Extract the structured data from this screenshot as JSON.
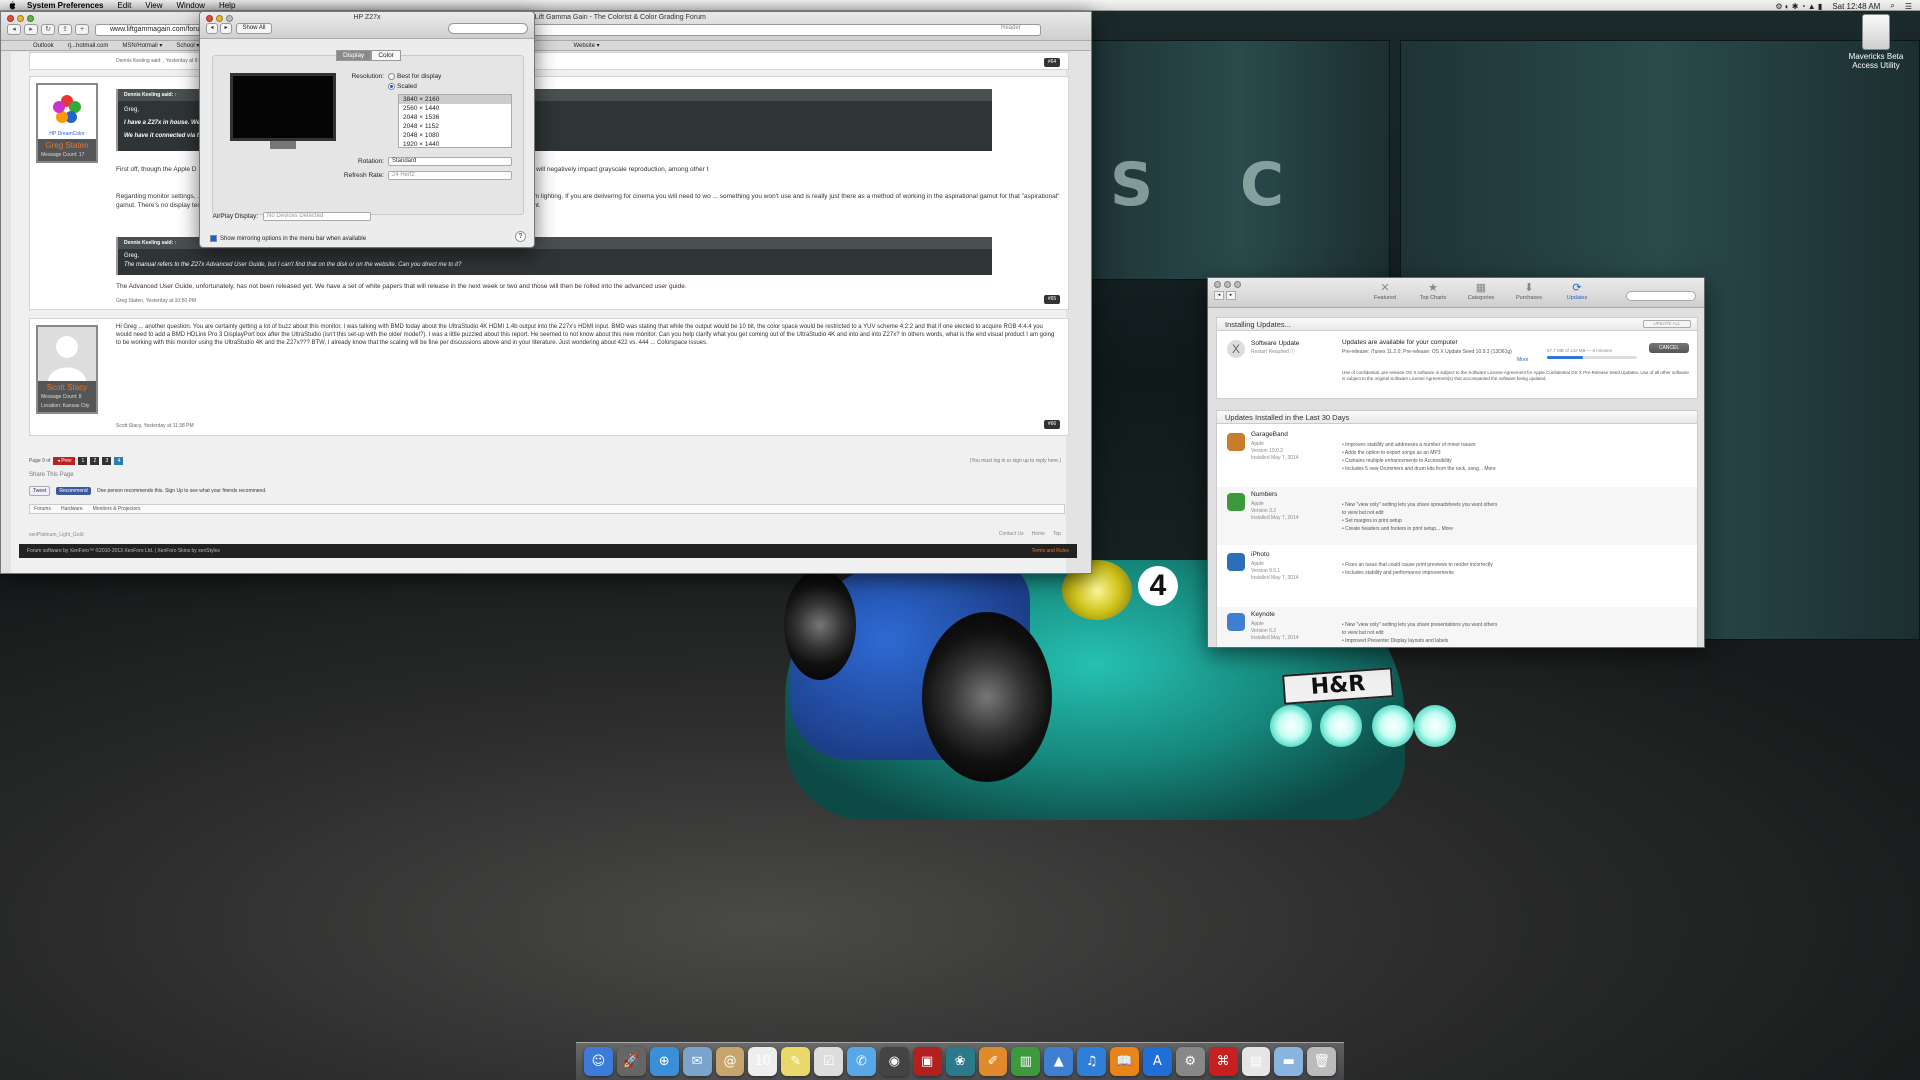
{
  "menubar": {
    "app_name": "System Preferences",
    "items": [
      "Edit",
      "View",
      "Window",
      "Help"
    ],
    "clock": "Sat 12:48 AM"
  },
  "desktop_icon": {
    "label": "Mavericks Beta Access Utility"
  },
  "browser": {
    "title": "| Lift Gamma Gain - The Colorist & Color Grading Forum",
    "url": "www.liftgammagain.com/forum/in",
    "bookmarks": [
      "Outlook",
      "rj...hotmail.com",
      "MSN/Hotmail ▾",
      "School ▾",
      "Website ▾"
    ],
    "search_placeholder": "Reader",
    "posts": [
      {
        "footer_top": "Dennis Keeling said: , Yesterday at 9:49 PM",
        "number": "#64"
      },
      {
        "author": "Greg Staten",
        "message_count": "Message Count: 17",
        "quote_header": "Dennis Keeling said: ↑",
        "quote_lines": [
          "Greg,",
          "I have a Z27x in house. We ... nitor via HDMI. Do you have any recommendations for monitor settings for this configuration?",
          "We have it connected via th ... ears very bright and washed out."
        ],
        "body_1": "First off, though the Apple D ... st beta release of OS X Mavericks (10.9.3). If you don't do this there will be some, shall we say, visual artifacts that will negatively impact grayscale reproduction, among other t",
        "body_2": "Regarding monitor settings, ... ering for television you should be working within the BT.709 gamut and with a 2.4 gamma if you are working with dim lighting. If you are delivering for cinema you will need to wo ... something you won't use and is really just there as a method of working in the aspirational gamut for that \"aspirational\" gamut. There's no display technology yet that can even approach ... 20, which is more than just about anything out there - certainly at its price point.",
        "quote2_header": "Dennis Keeling said: ↑",
        "quote2_lines": [
          "Greg,",
          "The manual refers to the Z27x Advanced User Guide, but I can't find that on the disk or on the website. Can you direct me to it?"
        ],
        "body_3": "The Advanced User Guide, unfortunately, has not been released yet. We have a set of white papers that will release in the next week or two and those will then be rolled into the advanced user guide.",
        "footer": "Greg Staten, Yesterday at 10:50 PM",
        "number": "#65"
      },
      {
        "author": "Scott Stacy",
        "message_count": "Message Count: 8",
        "location": "Location: Kansas City",
        "body": "Hi Greg ... another question. You are certainly getting a lot of buzz about this monitor. I was talking with BMD today about the UltraStudio 4K HDMI 1.4b output into the Z27x's HDMI input. BMD was stating that while the output would be 10 bit, the color space would be restricted to a YUV scheme 4:2:2 and that if one elected to acquire RGB 4:4:4 you would need to add a BMD HDLink Pro 3 DisplayPort box after the UltraStudio (isn't this set-up with the older model?). I was a little puzzled about this report. He seemed to not know about this new monitor. Can you help clarify what you get coming out of the UltraStudio 4K and into and into Z27x? In others words, what is the end visual product I am going to be working with this monitor using the UltraStudio 4K and the Z27x??? BTW, I already know that the scaling will be fine per discussions above and in your literature. Just wondering about 422 vs. 444 ... Colorspace issues.",
        "footer": "Scott Stacy, Yesterday at 11:38 PM",
        "number": "#66"
      }
    ],
    "pager": {
      "label": "Page 9 of",
      "prev": "◂ Prev",
      "pages": [
        "1",
        "2",
        "3",
        "4"
      ],
      "login_note": "(You must log in or sign up to reply here.)"
    },
    "share_title": "Share This Page",
    "tweet": "Tweet",
    "recommend": "Recommend",
    "recommend_note": "One person recommends this. Sign Up to see what your friends recommend.",
    "crumbs": [
      "Forums",
      "Hardware",
      "Monitors & Projectors"
    ],
    "style_name": "xenPlatinum_Light_Gold",
    "contact_links": [
      "Contact Us",
      "Home",
      "Top"
    ],
    "copyright": "Forum software by XenForo™ ©2010-2013 XenForo Ltd. | XenForo Skins by xenStyles",
    "terms": "Terms and Rules"
  },
  "display_prefs": {
    "title": "HP Z27x",
    "show_all": "Show All",
    "tabs": [
      "Display",
      "Color"
    ],
    "resolution_label": "Resolution:",
    "radio_best": "Best for display",
    "radio_scaled": "Scaled",
    "resolutions": [
      "3840 × 2160",
      "2560 × 1440",
      "2048 × 1536",
      "2048 × 1152",
      "2048 × 1080",
      "1920 × 1440"
    ],
    "rotation_label": "Rotation:",
    "rotation_value": "Standard",
    "refresh_label": "Refresh Rate:",
    "refresh_value": "24 Hertz",
    "airplay_label": "AirPlay Display:",
    "airplay_value": "No Devices Detected",
    "mirroring": "Show mirroring options in the menu bar when available",
    "help": "?"
  },
  "app_store": {
    "tabs": [
      {
        "label": "Featured",
        "icon": "✕"
      },
      {
        "label": "Top Charts",
        "icon": "★"
      },
      {
        "label": "Categories",
        "icon": "▦"
      },
      {
        "label": "Purchases",
        "icon": "⬇"
      },
      {
        "label": "Updates",
        "icon": "⟳"
      }
    ],
    "installing_title": "Installing Updates...",
    "update_all": "UPDATE ALL",
    "software_update": {
      "name": "Software Update",
      "status": "Restart Required ⓘ",
      "headline": "Updates are available for your computer",
      "detail": "Pre-release: iTunes 11.2.0, Pre-release: OS X Update Seed 10.9.3 (13D61g)",
      "more": "More",
      "progress": "57.7 MB of 142 MB — 8 minutes",
      "progress_pct": 40,
      "cancel": "CANCEL",
      "license": "Use of confidential, pre-release OS X software is subject to the Software License Agreement for Apple Confidential OS X Pre-Release Seed Updates. Use of all other software is subject to the original Software License Agreement(s) that accompanied the software being updated."
    },
    "installed_title": "Updates Installed in the Last 30 Days",
    "installed": [
      {
        "name": "GarageBand",
        "vendor": "Apple",
        "version": "Version 10.0.2",
        "date": "Installed May 7, 2014",
        "notes": [
          "• Improves stability and addresses a number of minor issues",
          "• Adds the option to export songs as an MP3",
          "• Contains multiple enhancements to Accessibility",
          "• Includes 5 new Drummers and drum kits from the rock, song... More"
        ],
        "color": "#c97c2a"
      },
      {
        "name": "Numbers",
        "vendor": "Apple",
        "version": "Version 3.2",
        "date": "Installed May 7, 2014",
        "notes": [
          "• New \"view only\" setting lets you share spreadsheets you want others",
          "   to view but not edit",
          "• Set margins in print setup",
          "• Create headers and footers in print setup... More"
        ],
        "color": "#3c9a3c"
      },
      {
        "name": "iPhoto",
        "vendor": "Apple",
        "version": "Version 9.5.1",
        "date": "Installed May 7, 2014",
        "notes": [
          "• Fixes an issue that could cause print previews to render incorrectly",
          "• Includes stability and performance improvements"
        ],
        "color": "#2b6fb8"
      },
      {
        "name": "Keynote",
        "vendor": "Apple",
        "version": "Version 6.2",
        "date": "Installed May 7, 2014",
        "notes": [
          "• New \"view only\" setting lets you share presentations you want others",
          "   to view but not edit",
          "• Improved Presenter Display layouts and labels"
        ],
        "color": "#3e7fd2"
      }
    ]
  },
  "dock": [
    {
      "name": "finder-icon",
      "glyph": "☺",
      "color": "#3d7bd8"
    },
    {
      "name": "launchpad-icon",
      "glyph": "🚀",
      "color": "#666"
    },
    {
      "name": "safari-icon",
      "glyph": "⊕",
      "color": "#3b8fd9"
    },
    {
      "name": "mail-icon",
      "glyph": "✉",
      "color": "#7aa4cc"
    },
    {
      "name": "contacts-icon",
      "glyph": "@",
      "color": "#c6a46b"
    },
    {
      "name": "calendar-icon",
      "glyph": "10",
      "color": "#eeeeee"
    },
    {
      "name": "notes-icon",
      "glyph": "✎",
      "color": "#e8d96a"
    },
    {
      "name": "reminders-icon",
      "glyph": "☑",
      "color": "#dddddd"
    },
    {
      "name": "messages-icon",
      "glyph": "✆",
      "color": "#56a8e8"
    },
    {
      "name": "facetime-icon",
      "glyph": "◉",
      "color": "#444"
    },
    {
      "name": "photo-booth-icon",
      "glyph": "▣",
      "color": "#b32020"
    },
    {
      "name": "iphoto-icon",
      "glyph": "❀",
      "color": "#2a7a8c"
    },
    {
      "name": "pages-icon",
      "glyph": "✐",
      "color": "#e08a2c"
    },
    {
      "name": "numbers-icon",
      "glyph": "▥",
      "color": "#3c9a3c"
    },
    {
      "name": "keynote-icon",
      "glyph": "▲",
      "color": "#3e7fd2"
    },
    {
      "name": "itunes-icon",
      "glyph": "♫",
      "color": "#2f7ed8"
    },
    {
      "name": "ibooks-icon",
      "glyph": "📖",
      "color": "#e8841a"
    },
    {
      "name": "app-store-icon",
      "glyph": "A",
      "color": "#1f6fd6"
    },
    {
      "name": "system-preferences-icon",
      "glyph": "⚙",
      "color": "#888"
    },
    {
      "name": "acrobat-icon",
      "glyph": "⌘",
      "color": "#c82020"
    },
    {
      "name": "document-icon",
      "glyph": "▤",
      "color": "#e6e6e6"
    },
    {
      "name": "downloads-folder-icon",
      "glyph": "▬",
      "color": "#8ab4e0"
    },
    {
      "name": "trash-icon",
      "glyph": "🗑",
      "color": "#bbbbbb"
    }
  ],
  "car_plate": "H&R",
  "car_number": "4"
}
